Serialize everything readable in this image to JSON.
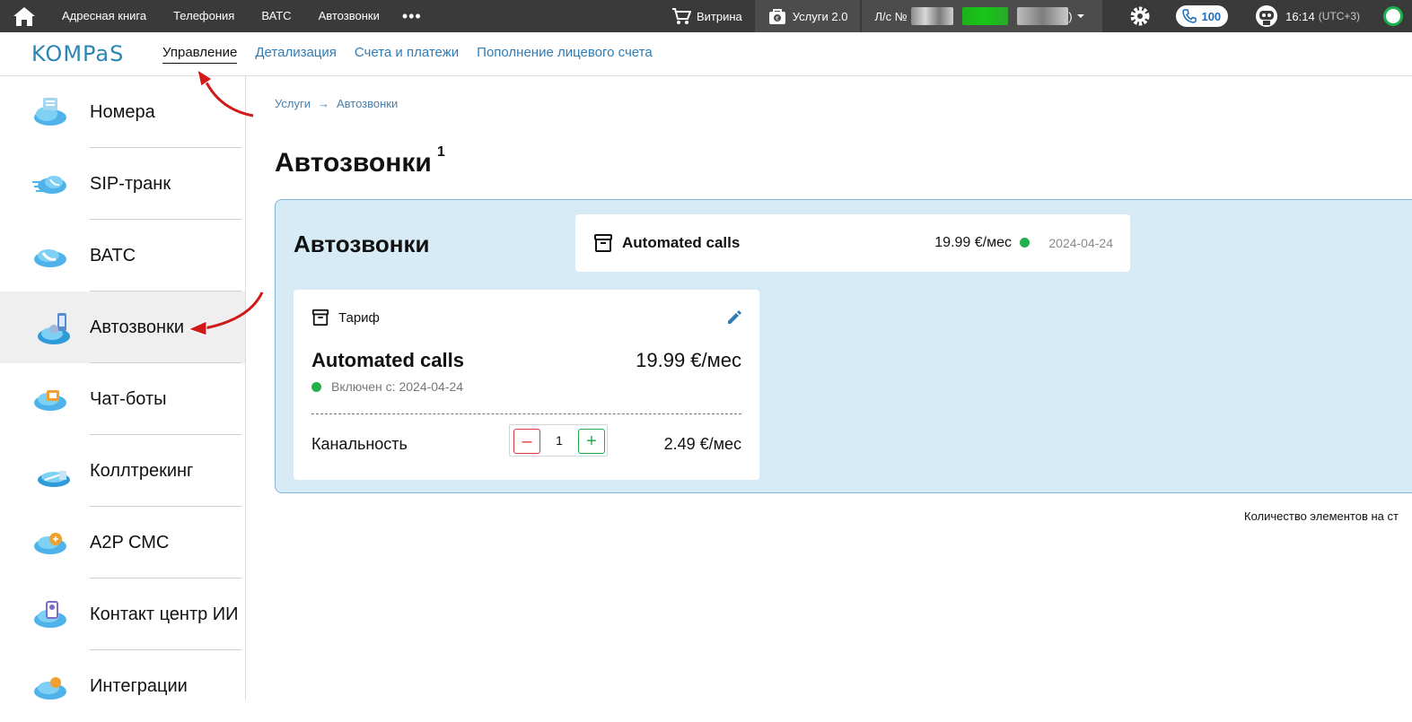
{
  "topbar": {
    "nav": [
      "Адресная книга",
      "Телефония",
      "ВАТС",
      "Автозвонки"
    ],
    "more": "•••",
    "showcase": "Витрина",
    "services": "Услуги 2.0",
    "account_prefix": "Л/с №",
    "account_suffix": ")",
    "calls_count": "100",
    "time": "16:14",
    "timezone": "(UTC+3)"
  },
  "subnav": {
    "logo": "KOMPaS",
    "links": [
      "Управление",
      "Детализация",
      "Счета и платежи",
      "Пополнение лицевого счета"
    ]
  },
  "sidebar": {
    "items": [
      {
        "label": "Номера"
      },
      {
        "label": "SIP-транк"
      },
      {
        "label": "ВАТС"
      },
      {
        "label": "Автозвонки"
      },
      {
        "label": "Чат-боты"
      },
      {
        "label": "Коллтрекинг"
      },
      {
        "label": "A2P СМС"
      },
      {
        "label": "Контакт центр ИИ"
      },
      {
        "label": "Интеграции"
      }
    ]
  },
  "breadcrumb": {
    "root": "Услуги",
    "separator": "→",
    "current": "Автозвонки"
  },
  "page": {
    "title": "Автозвонки",
    "count": "1"
  },
  "panel": {
    "title": "Автозвонки",
    "summary": {
      "name": "Automated calls",
      "price": "19.99 €/мес",
      "date": "2024-04-24"
    },
    "card": {
      "label": "Тариф",
      "name": "Automated calls",
      "price": "19.99 €/мес",
      "status": "Включен с: 2024-04-24",
      "channels_label": "Канальность",
      "minus": "–",
      "quantity": "1",
      "plus": "+",
      "channels_price": "2.49 €/мес"
    }
  },
  "pager_text": "Количество элементов на ст",
  "colors": {
    "accent": "#2e7cb6",
    "panel_bg": "#d7ebf7",
    "active_green": "#22b04b",
    "minus_red": "#e03b3b",
    "annotation_red": "#d01919"
  }
}
